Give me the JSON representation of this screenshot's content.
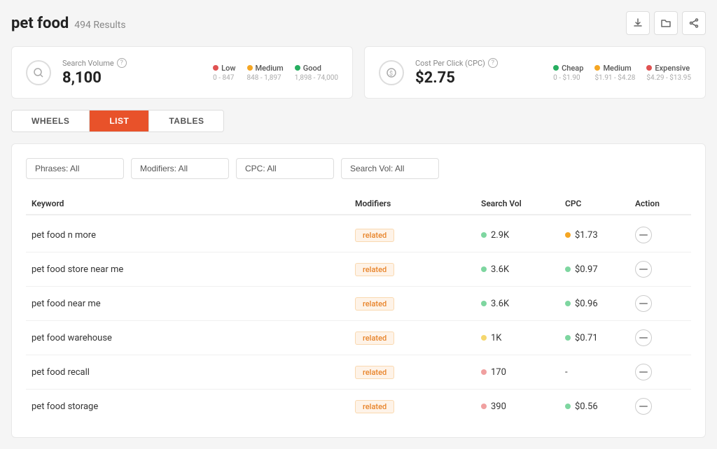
{
  "header": {
    "title": "pet food",
    "results": "494 Results"
  },
  "toolbar": {
    "download_label": "⬇",
    "folder_label": "🗁",
    "share_label": "⬡"
  },
  "stat_cards": [
    {
      "id": "search-volume",
      "icon": "🔍",
      "label": "Search Volume",
      "value": "8,100",
      "legend": [
        {
          "color": "#e05252",
          "name": "Low",
          "range": "0 - 847"
        },
        {
          "color": "#f5a623",
          "name": "Medium",
          "range": "848 - 1,897"
        },
        {
          "color": "#27ae60",
          "name": "Good",
          "range": "1,898 - 74,000"
        }
      ]
    },
    {
      "id": "cpc",
      "icon": "$",
      "label": "Cost Per Click (CPC)",
      "value": "$2.75",
      "legend": [
        {
          "color": "#27ae60",
          "name": "Cheap",
          "range": "0 - $1.90"
        },
        {
          "color": "#f5a623",
          "name": "Medium",
          "range": "$1.91 - $4.28"
        },
        {
          "color": "#e05252",
          "name": "Expensive",
          "range": "$4.29 - $13.95"
        }
      ]
    }
  ],
  "tabs": [
    {
      "id": "wheels",
      "label": "WHEELS",
      "active": false
    },
    {
      "id": "list",
      "label": "LIST",
      "active": true
    },
    {
      "id": "tables",
      "label": "TABLES",
      "active": false
    }
  ],
  "filters": [
    {
      "id": "phrases",
      "value": "Phrases: All"
    },
    {
      "id": "modifiers",
      "value": "Modifiers: All"
    },
    {
      "id": "cpc",
      "value": "CPC: All"
    },
    {
      "id": "searchvol",
      "value": "Search Vol: All"
    }
  ],
  "table": {
    "columns": [
      "Keyword",
      "Modifiers",
      "Search Vol",
      "CPC",
      "Action"
    ],
    "rows": [
      {
        "keyword": "pet food n more",
        "modifier": "related",
        "search_vol": "2.9K",
        "vol_color": "#7ed6a0",
        "cpc": "$1.73",
        "cpc_color": "#f5a623"
      },
      {
        "keyword": "pet food store near me",
        "modifier": "related",
        "search_vol": "3.6K",
        "vol_color": "#7ed6a0",
        "cpc": "$0.97",
        "cpc_color": "#7ed6a0"
      },
      {
        "keyword": "pet food near me",
        "modifier": "related",
        "search_vol": "3.6K",
        "vol_color": "#7ed6a0",
        "cpc": "$0.96",
        "cpc_color": "#7ed6a0"
      },
      {
        "keyword": "pet food warehouse",
        "modifier": "related",
        "search_vol": "1K",
        "vol_color": "#f5d76e",
        "cpc": "$0.71",
        "cpc_color": "#7ed6a0"
      },
      {
        "keyword": "pet food recall",
        "modifier": "related",
        "search_vol": "170",
        "vol_color": "#f0a0a0",
        "cpc": "-",
        "cpc_color": null
      },
      {
        "keyword": "pet food storage",
        "modifier": "related",
        "search_vol": "390",
        "vol_color": "#f0a0a0",
        "cpc": "$0.56",
        "cpc_color": "#7ed6a0"
      }
    ]
  }
}
